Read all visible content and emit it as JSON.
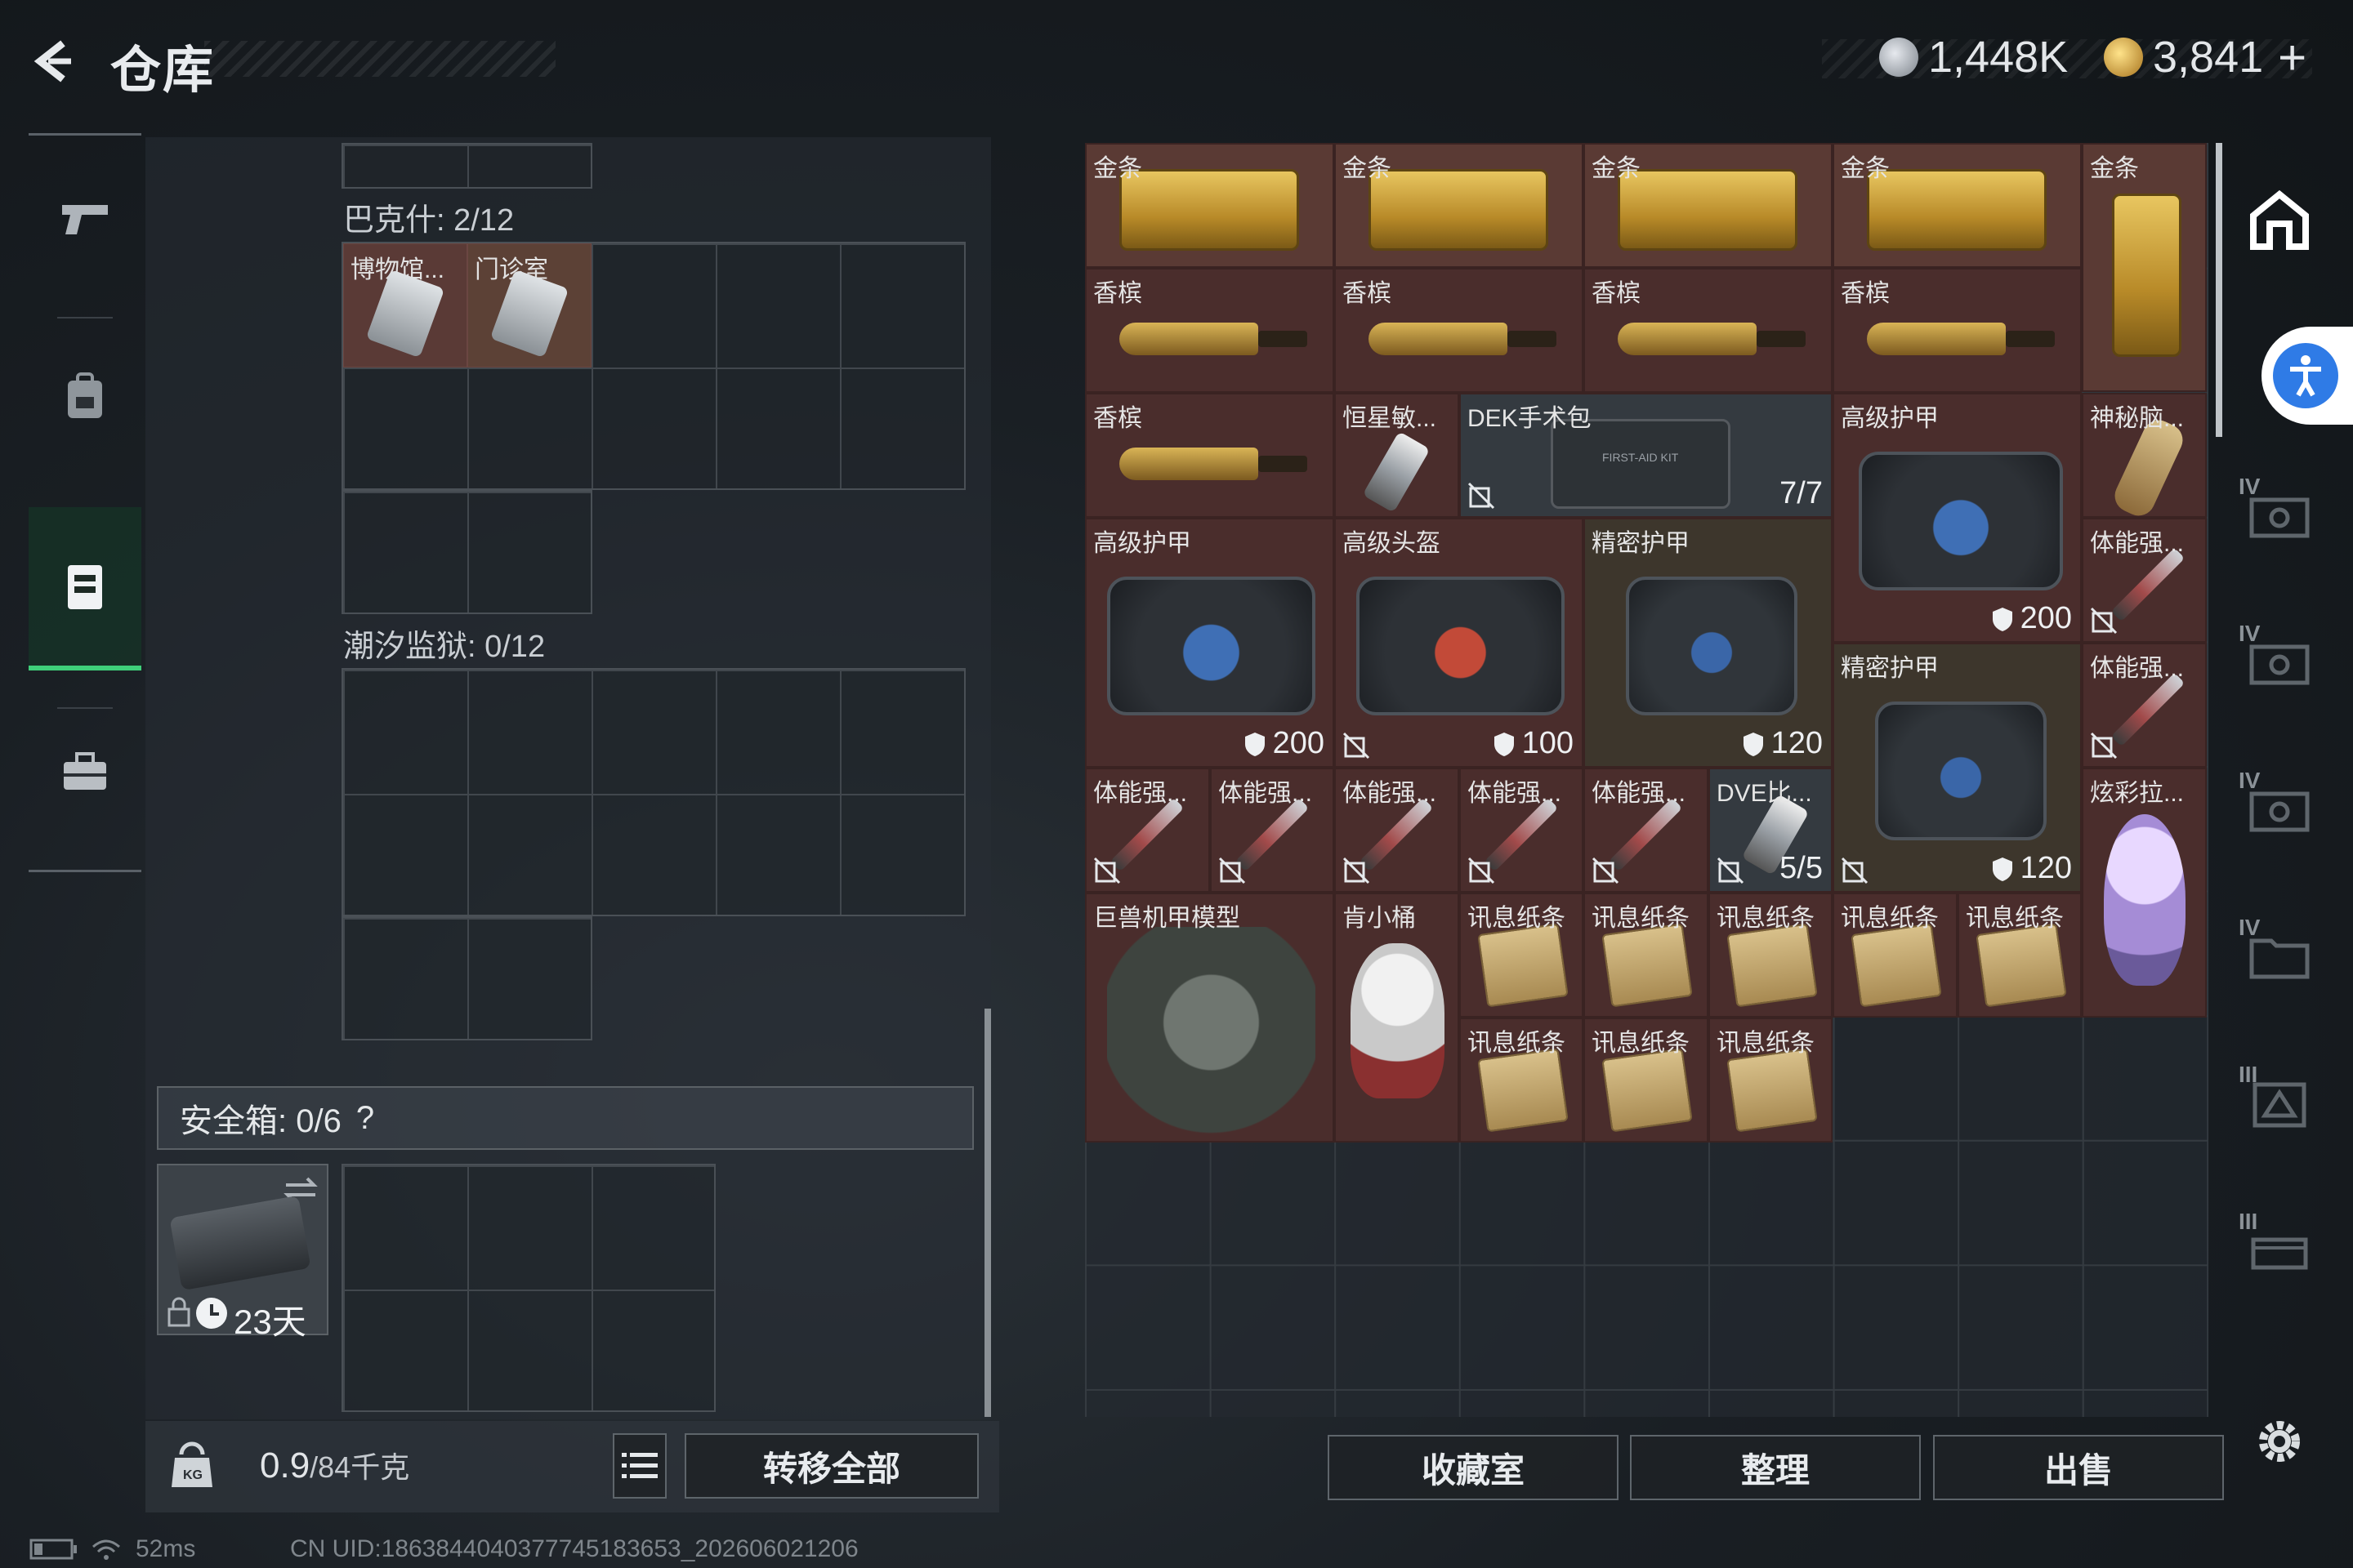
{
  "header": {
    "title": "仓库",
    "currency_silver": "1,448K",
    "currency_gold": "3,841",
    "plus": "+"
  },
  "left_nav": [
    "weapon",
    "backpack",
    "vest",
    "briefcase"
  ],
  "left_panel": {
    "section1_label": "巴克什: 2/12",
    "section1_items": [
      "博物馆...",
      "门诊室"
    ],
    "section2_label": "潮汐监狱: 0/12",
    "safebox_label": "安全箱: 0/6",
    "safebox_help": "?",
    "safebox_timer": "23天",
    "weight_value": "0.9",
    "weight_max": "/84千克",
    "transfer_all": "转移全部"
  },
  "stash": {
    "items": [
      {
        "label": "金条"
      },
      {
        "label": "金条"
      },
      {
        "label": "金条"
      },
      {
        "label": "金条"
      },
      {
        "label": "金条"
      },
      {
        "label": "香槟"
      },
      {
        "label": "香槟"
      },
      {
        "label": "香槟"
      },
      {
        "label": "香槟"
      },
      {
        "label": "香槟"
      },
      {
        "label": "恒星敏..."
      },
      {
        "label": "DEK手术包",
        "value": "7/7"
      },
      {
        "label": "高级护甲",
        "value": "200"
      },
      {
        "label": "神秘脑..."
      },
      {
        "label": "高级护甲",
        "value": "200"
      },
      {
        "label": "高级头盔",
        "value": "100"
      },
      {
        "label": "精密护甲",
        "value": "120"
      },
      {
        "label": "体能强..."
      },
      {
        "label": "精密护甲",
        "value": "120"
      },
      {
        "label": "体能强..."
      },
      {
        "label": "体能强..."
      },
      {
        "label": "体能强..."
      },
      {
        "label": "体能强..."
      },
      {
        "label": "体能强..."
      },
      {
        "label": "体能强..."
      },
      {
        "label": "DVE比...",
        "value": "5/5"
      },
      {
        "label": "炫彩拉..."
      },
      {
        "label": "巨兽机甲模型"
      },
      {
        "label": "肯小桶"
      },
      {
        "label": "讯息纸条"
      },
      {
        "label": "讯息纸条"
      },
      {
        "label": "讯息纸条"
      },
      {
        "label": "讯息纸条"
      },
      {
        "label": "讯息纸条"
      },
      {
        "label": "讯息纸条"
      },
      {
        "label": "讯息纸条"
      },
      {
        "label": "讯息纸条"
      }
    ]
  },
  "right_rail": [
    "IV",
    "IV",
    "IV",
    "IV",
    "IV",
    "III",
    "III"
  ],
  "buttons": {
    "collection": "收藏室",
    "organize": "整理",
    "sell": "出售"
  },
  "status": {
    "ping": "52ms",
    "uid": "CN UID:1863844040377745183653_202606021206"
  },
  "colors": {
    "accent_green": "#3fd07a",
    "item_bg": "#4a2d2c",
    "accessibility_blue": "#2f7be6"
  }
}
